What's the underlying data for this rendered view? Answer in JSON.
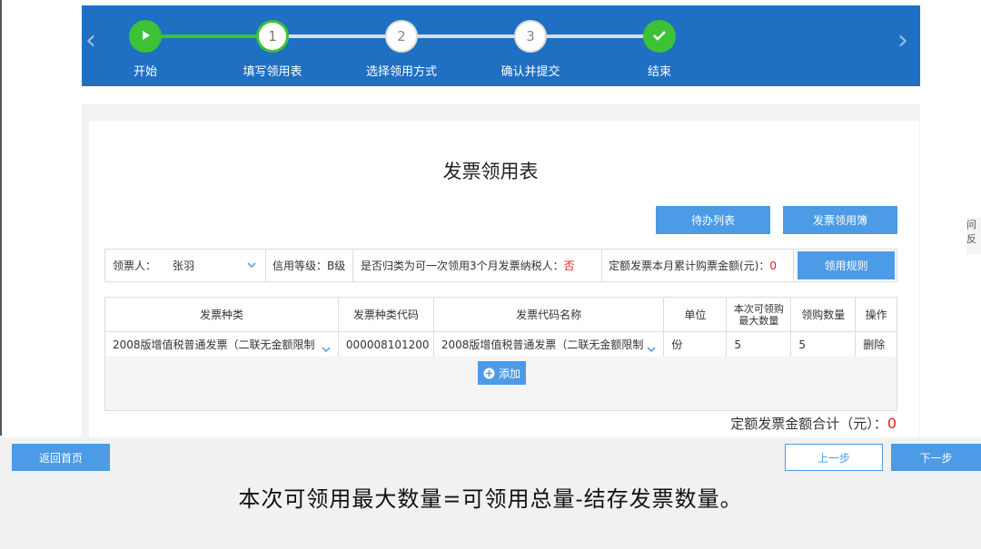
{
  "stepper": {
    "steps": [
      {
        "number": "",
        "label": "开始",
        "state": "done",
        "icon": "play-icon"
      },
      {
        "number": "1",
        "label": "填写领用表",
        "state": "current"
      },
      {
        "number": "2",
        "label": "选择领用方式",
        "state": "todo"
      },
      {
        "number": "3",
        "label": "确认并提交",
        "state": "todo"
      },
      {
        "number": "",
        "label": "结束",
        "state": "done",
        "icon": "check-icon"
      }
    ],
    "prev_arrow": "‹",
    "next_arrow": "›"
  },
  "page_title": "发票领用表",
  "actions": {
    "todo_list": "待办列表",
    "ledger": "发票领用簿"
  },
  "info": {
    "recipient_label": "领票人：",
    "recipient_value": "张羽",
    "credit_label": "信用等级：",
    "credit_value": "B级",
    "three_month_label": "是否归类为可一次领用3个月发票纳税人：",
    "three_month_value": "否",
    "fixed_amount_label": "定额发票本月累计购票金额(元)：",
    "fixed_amount_value": "0",
    "rules_button": "领用规则"
  },
  "table": {
    "headers": [
      "发票种类",
      "发票种类代码",
      "发票代码名称",
      "单位",
      "本次可领购最大数量",
      "领购数量",
      "操作"
    ],
    "rows": [
      {
        "type": "2008版增值税普通发票（二联无金额限制",
        "type_code": "000008101200",
        "code_name": "2008版增值税普通发票（二联无金额限制",
        "unit": "份",
        "max_qty": "5",
        "qty": "5",
        "action": "删除"
      }
    ],
    "add_label": "添加"
  },
  "total": {
    "label": "定额发票金额合计（元）：",
    "value": "0"
  },
  "bottom": {
    "home": "返回首页",
    "prev": "上一步",
    "next": "下一步"
  },
  "caption": "本次可领用最大数量=可领用总量-结存发票数量。",
  "right_fragment": {
    "line1": "问",
    "line2": "反"
  },
  "colors": {
    "header_blue": "#1f6fc2",
    "button_blue": "#4c9be6",
    "green": "#3cc236",
    "red": "#e02020"
  }
}
